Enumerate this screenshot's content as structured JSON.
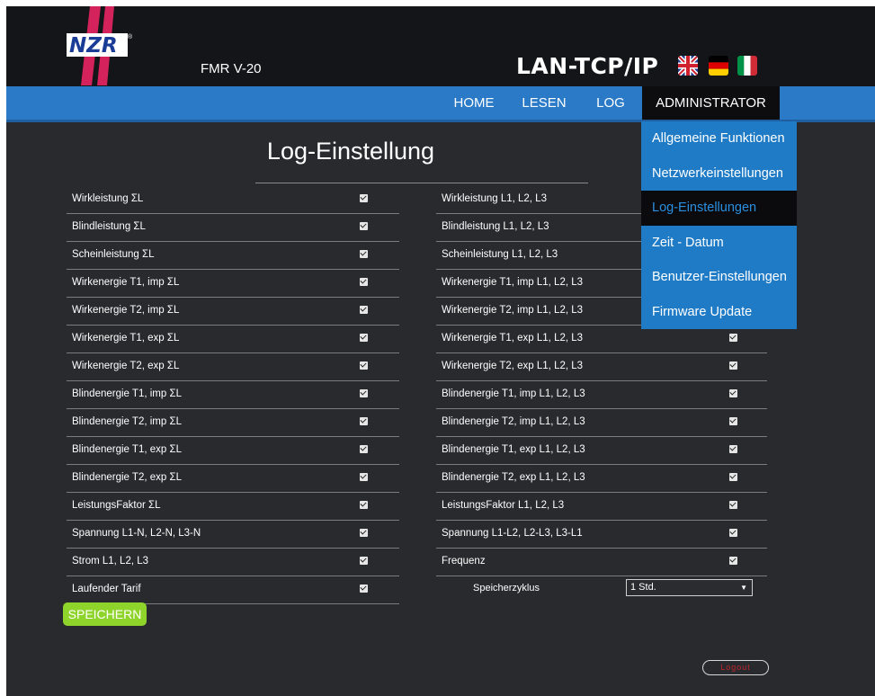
{
  "header": {
    "logo_text": "NZR",
    "model": "FMR V-20",
    "product": "LAN-TCP/IP",
    "flags": [
      "flag-uk-icon",
      "flag-de-icon",
      "flag-it-icon"
    ]
  },
  "nav": {
    "home": "HOME",
    "lesen": "LESEN",
    "log": "LOG",
    "admin": "ADMINISTRATOR"
  },
  "dropdown": {
    "items": [
      {
        "label": "Allgemeine Funktionen",
        "active": false
      },
      {
        "label": "Netzwerkeinstellungen",
        "active": false
      },
      {
        "label": "Log-Einstellungen",
        "active": true
      },
      {
        "label": "Zeit - Datum",
        "active": false
      },
      {
        "label": "Benutzer-Einstellungen",
        "active": false
      },
      {
        "label": "Firmware Update",
        "active": false
      }
    ]
  },
  "page": {
    "title": "Log-Einstellung"
  },
  "left_rows": [
    {
      "label": "Wirkleistung ΣL",
      "checked": true
    },
    {
      "label": "Blindleistung ΣL",
      "checked": true
    },
    {
      "label": "Scheinleistung ΣL",
      "checked": true
    },
    {
      "label": "Wirkenergie T1, imp ΣL",
      "checked": true
    },
    {
      "label": "Wirkenergie T2, imp ΣL",
      "checked": true
    },
    {
      "label": "Wirkenergie T1, exp ΣL",
      "checked": true
    },
    {
      "label": "Wirkenergie T2, exp ΣL",
      "checked": true
    },
    {
      "label": "Blindenergie T1, imp ΣL",
      "checked": true
    },
    {
      "label": "Blindenergie T2, imp ΣL",
      "checked": true
    },
    {
      "label": "Blindenergie T1, exp ΣL",
      "checked": true
    },
    {
      "label": "Blindenergie T2, exp ΣL",
      "checked": true
    },
    {
      "label": "LeistungsFaktor ΣL",
      "checked": true
    },
    {
      "label": "Spannung L1-N, L2-N, L3-N",
      "checked": true
    },
    {
      "label": "Strom L1, L2, L3",
      "checked": true
    },
    {
      "label": "Laufender Tarif",
      "checked": true
    }
  ],
  "right_rows": [
    {
      "label": "Wirkleistung L1, L2, L3",
      "checked": true
    },
    {
      "label": "Blindleistung L1, L2, L3",
      "checked": true
    },
    {
      "label": "Scheinleistung L1, L2, L3",
      "checked": true
    },
    {
      "label": "Wirkenergie T1, imp L1, L2, L3",
      "checked": true
    },
    {
      "label": "Wirkenergie T2, imp L1, L2, L3",
      "checked": true
    },
    {
      "label": "Wirkenergie T1, exp L1, L2, L3",
      "checked": true
    },
    {
      "label": "Wirkenergie T2, exp L1, L2, L3",
      "checked": true
    },
    {
      "label": "Blindenergie T1, imp L1, L2, L3",
      "checked": true
    },
    {
      "label": "Blindenergie T2, imp L1, L2, L3",
      "checked": true
    },
    {
      "label": "Blindenergie T1, exp L1, L2, L3",
      "checked": true
    },
    {
      "label": "Blindenergie T2, exp L1, L2, L3",
      "checked": true
    },
    {
      "label": "LeistungsFaktor L1, L2, L3",
      "checked": true
    },
    {
      "label": "Spannung L1-L2, L2-L3, L3-L1",
      "checked": true
    },
    {
      "label": "Frequenz",
      "checked": true
    }
  ],
  "speicher": {
    "label": "Speicherzyklus",
    "value": "1 Std."
  },
  "buttons": {
    "save": "SPEICHERN",
    "logout": "Logout"
  },
  "colors": {
    "nav_blue": "#2a7ac8",
    "save_green": "#8fd42b",
    "logout_red": "#c0262b",
    "background": "#292a2e"
  }
}
